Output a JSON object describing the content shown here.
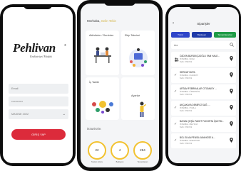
{
  "login": {
    "logo_text": "Pehlivan",
    "logo_mark": "®",
    "logo_subtitle": "Endüstriyel Mutfak",
    "username_placeholder": "Email",
    "password_mask": "••••••••••••",
    "select_value": "MAKINE 2022",
    "login_button": "GİRİŞ YAP",
    "accent_color": "#dc2b3b"
  },
  "dashboard": {
    "greeting_prefix": "Merhaba,",
    "greeting_name": "Selin Tekin",
    "cards": [
      {
        "title": "Aktiviteler / Servisler"
      },
      {
        "title": "Ekip Takvimi"
      },
      {
        "title": "İş Takibi"
      },
      {
        "title": "Ayarlar"
      }
    ],
    "stats_title": "İSTATİSTİK",
    "stats": [
      {
        "value": "22",
        "label": "Toplam Görev"
      },
      {
        "value": "4",
        "label": "Bekleyen"
      },
      {
        "value": "284",
        "label": "Tamamlanan"
      }
    ],
    "ring_color": "#f2c230"
  },
  "list": {
    "title": "Siparişler",
    "tabs": [
      {
        "label": "Tümü",
        "color": "#2f45c9"
      },
      {
        "label": "Bekleyen",
        "color": "#1f3aa8"
      },
      {
        "label": "Tamamlananlar",
        "color": "#1f9b46"
      }
    ],
    "search_placeholder": "Ara",
    "rows": [
      {
        "title": "ÖZDEN BÜRÜKÇÜOĞLU FAM HALE...",
        "sub": "İSTANBUL / ŞİŞLİ",
        "sub2": "Tarih: 07/07/22"
      },
      {
        "title": "SERHAT BÜTA",
        "sub": "İSTANBUL / KADIKÖY",
        "sub2": "Tarih: 07/07/22"
      },
      {
        "title": "ARTAM FEBRIKALAR OTOMASY ...",
        "sub": "İSTANBUL / ÜMRANİYE",
        "sub2": "Tarih: 07/07/22"
      },
      {
        "title": "AKÇAKAYA DEMİRCİ SAĞ. ...",
        "sub": "İSTANBUL / TUZLA",
        "sub2": "Tarih: 07/07/22"
      },
      {
        "title": "BAYAN ÇEŞİL PAKET FUKORTA İŞLETM...",
        "sub": "İSTANBUL / BEYKOZ",
        "sub2": "Tarih: 07/07/22"
      },
      {
        "title": "BOL ELMA PENSILKAN/NOSE A...",
        "sub": "İSTANBUL / ESENYURT",
        "sub2": "Tarih: 07/07/22"
      }
    ],
    "row_icons": [
      "people-icon",
      "check-icon",
      "check-icon",
      "check-icon",
      "check-icon",
      "check-icon"
    ]
  }
}
